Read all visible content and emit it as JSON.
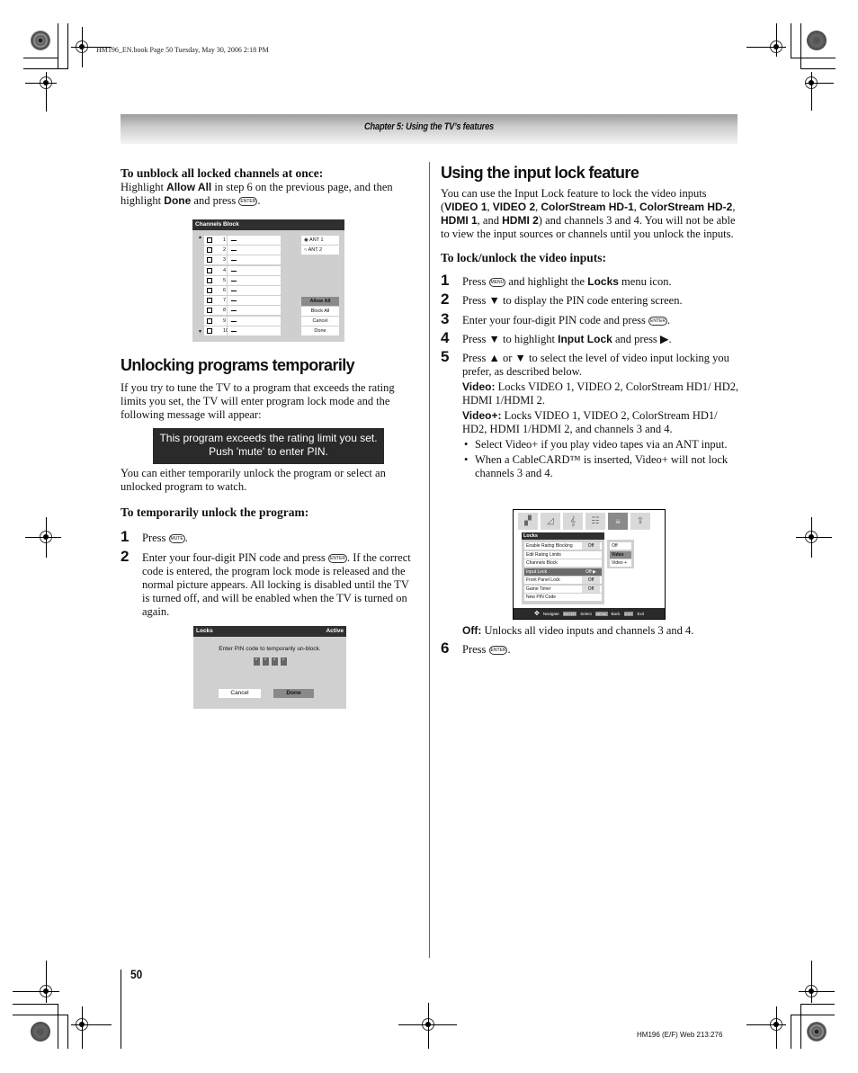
{
  "slug": "HM196_EN.book  Page 50  Tuesday, May 30, 2006  2:18 PM",
  "chapter_header": "Chapter 5: Using the TV’s features",
  "left": {
    "unblock": {
      "heading": "To unblock all locked channels at once:",
      "t1": "Highlight ",
      "b1": "Allow All",
      "t2": " in step 6 on the previous page, and then highlight ",
      "b2": "Done",
      "t3": " and press ",
      "button_icon": "ENTER",
      "t4": "."
    },
    "channels_block": {
      "title": "Channels Block",
      "channels": [
        "1",
        "2",
        "3",
        "4",
        "5",
        "6",
        "7",
        "8",
        "9",
        "10"
      ],
      "antenna_options": [
        {
          "label": "ANT 1",
          "selected": true
        },
        {
          "label": "ANT 2",
          "selected": false
        }
      ],
      "buttons": [
        {
          "label": "Allow All",
          "selected": true
        },
        {
          "label": "Block All",
          "selected": false
        },
        {
          "label": "Cancel",
          "selected": false
        },
        {
          "label": "Done",
          "selected": false
        }
      ],
      "scroll_up": "▲",
      "scroll_down": "▼"
    },
    "section_title": "Unlocking programs temporarily",
    "intro": "If you try to tune the TV to a program that exceeds the rating limits you set, the TV will enter program lock mode and the following message will appear:",
    "message_line1": "This program exceeds the rating limit you set.",
    "message_line2": "Push 'mute' to enter PIN.",
    "after_message": "You can either temporarily unlock the program or select an unlocked program to watch.",
    "temp_heading": "To temporarily unlock the program:",
    "steps": [
      {
        "num": "1",
        "t1": "Press ",
        "icon": "MUTE",
        "t2": "."
      },
      {
        "num": "2",
        "t1": "Enter your four-digit PIN code and press ",
        "icon": "ENTER",
        "t2": ". If the correct code is entered, the program lock mode is released and the normal picture appears. All locking is disabled until the TV is turned off, and will be enabled when the TV is turned on again."
      }
    ],
    "pin_screen": {
      "title": "Locks",
      "status": "Active",
      "message": "Enter PIN code to temporarily un-block.",
      "pin_dots": [
        "*",
        "*",
        "*",
        "*"
      ],
      "cancel": "Cancel",
      "done": "Done"
    }
  },
  "right": {
    "section_title": "Using the input lock feature",
    "intro": {
      "t1": "You can use the Input Lock feature to lock the video inputs (",
      "b1": "VIDEO 1",
      "s1": ", ",
      "b2": "VIDEO 2",
      "s2": ", ",
      "b3": "ColorStream HD-1",
      "s3": ", ",
      "b4": "ColorStream HD-2",
      "s4": ", ",
      "b5": "HDMI 1",
      "s5": ", and ",
      "b6": "HDMI 2",
      "t2": ") and channels 3 and 4. You will not be able to view the input sources or channels until you unlock the inputs."
    },
    "lock_heading": "To lock/unlock the video inputs:",
    "steps": [
      {
        "num": "1",
        "t1": "Press ",
        "icon": "MENU",
        "t2": " and highlight the ",
        "b": "Locks",
        "t3": " menu icon."
      },
      {
        "num": "2",
        "t1": "Press ▼ to display the PIN code entering screen."
      },
      {
        "num": "3",
        "t1": "Enter your four-digit PIN code and press ",
        "icon": "ENTER",
        "t2": "."
      },
      {
        "num": "4",
        "t1": "Press ▼ to highlight ",
        "b": "Input Lock",
        "t2": " and press ▶."
      },
      {
        "num": "5",
        "t1": "Press ▲ or ▼ to select the level of video input locking you prefer, as described below."
      }
    ],
    "video_label": "Video:",
    "video_desc": " Locks VIDEO 1, VIDEO 2, ColorStream HD1/ HD2, HDMI 1/HDMI 2.",
    "videoplus_label": "Video+:",
    "videoplus_desc": " Locks VIDEO 1, VIDEO 2, ColorStream HD1/ HD2, HDMI 1/HDMI 2, and channels 3 and 4.",
    "bullets": [
      "Select Video+ if you play video tapes via an ANT input.",
      "When a CableCARD™ is inserted, Video+ will not lock channels 3 and 4."
    ],
    "locks_menu": {
      "icons": [
        "picture-icon",
        "audio-icon",
        "music-note-icon",
        "setup-icon",
        "lock-icon",
        "applications-icon"
      ],
      "title": "Locks",
      "items": [
        {
          "label": "Enable Rating Blocking",
          "value": "Off",
          "selected": false
        },
        {
          "label": "Edit Rating Limits",
          "value": "",
          "selected": false
        },
        {
          "label": "Channels Block",
          "value": "",
          "selected": false
        },
        {
          "label": "Input Lock",
          "value": "Off ▶",
          "selected": true
        },
        {
          "label": "Front Panel Lock",
          "value": "Off",
          "selected": false
        },
        {
          "label": "Game Timer",
          "value": "Off",
          "selected": false
        },
        {
          "label": "New PIN Code",
          "value": "",
          "selected": false
        }
      ],
      "options": [
        {
          "label": "Off",
          "selected": false
        },
        {
          "label": "Video",
          "selected": true
        },
        {
          "label": "Video +",
          "selected": false
        }
      ],
      "footer": {
        "navigate": "Navigate",
        "enter_key": "ENTER",
        "select": "Select",
        "menu_key": "MENU",
        "back": "Back",
        "exit_key": "EXIT",
        "exit": "Exit"
      }
    },
    "off_label": "Off:",
    "off_desc": " Unlocks all video inputs and channels 3 and 4.",
    "step6": {
      "num": "6",
      "t1": "Press ",
      "icon": "ENTER",
      "t2": "."
    }
  },
  "page_number": "50",
  "footer_code": "HM196 (E/F) Web 213:276"
}
